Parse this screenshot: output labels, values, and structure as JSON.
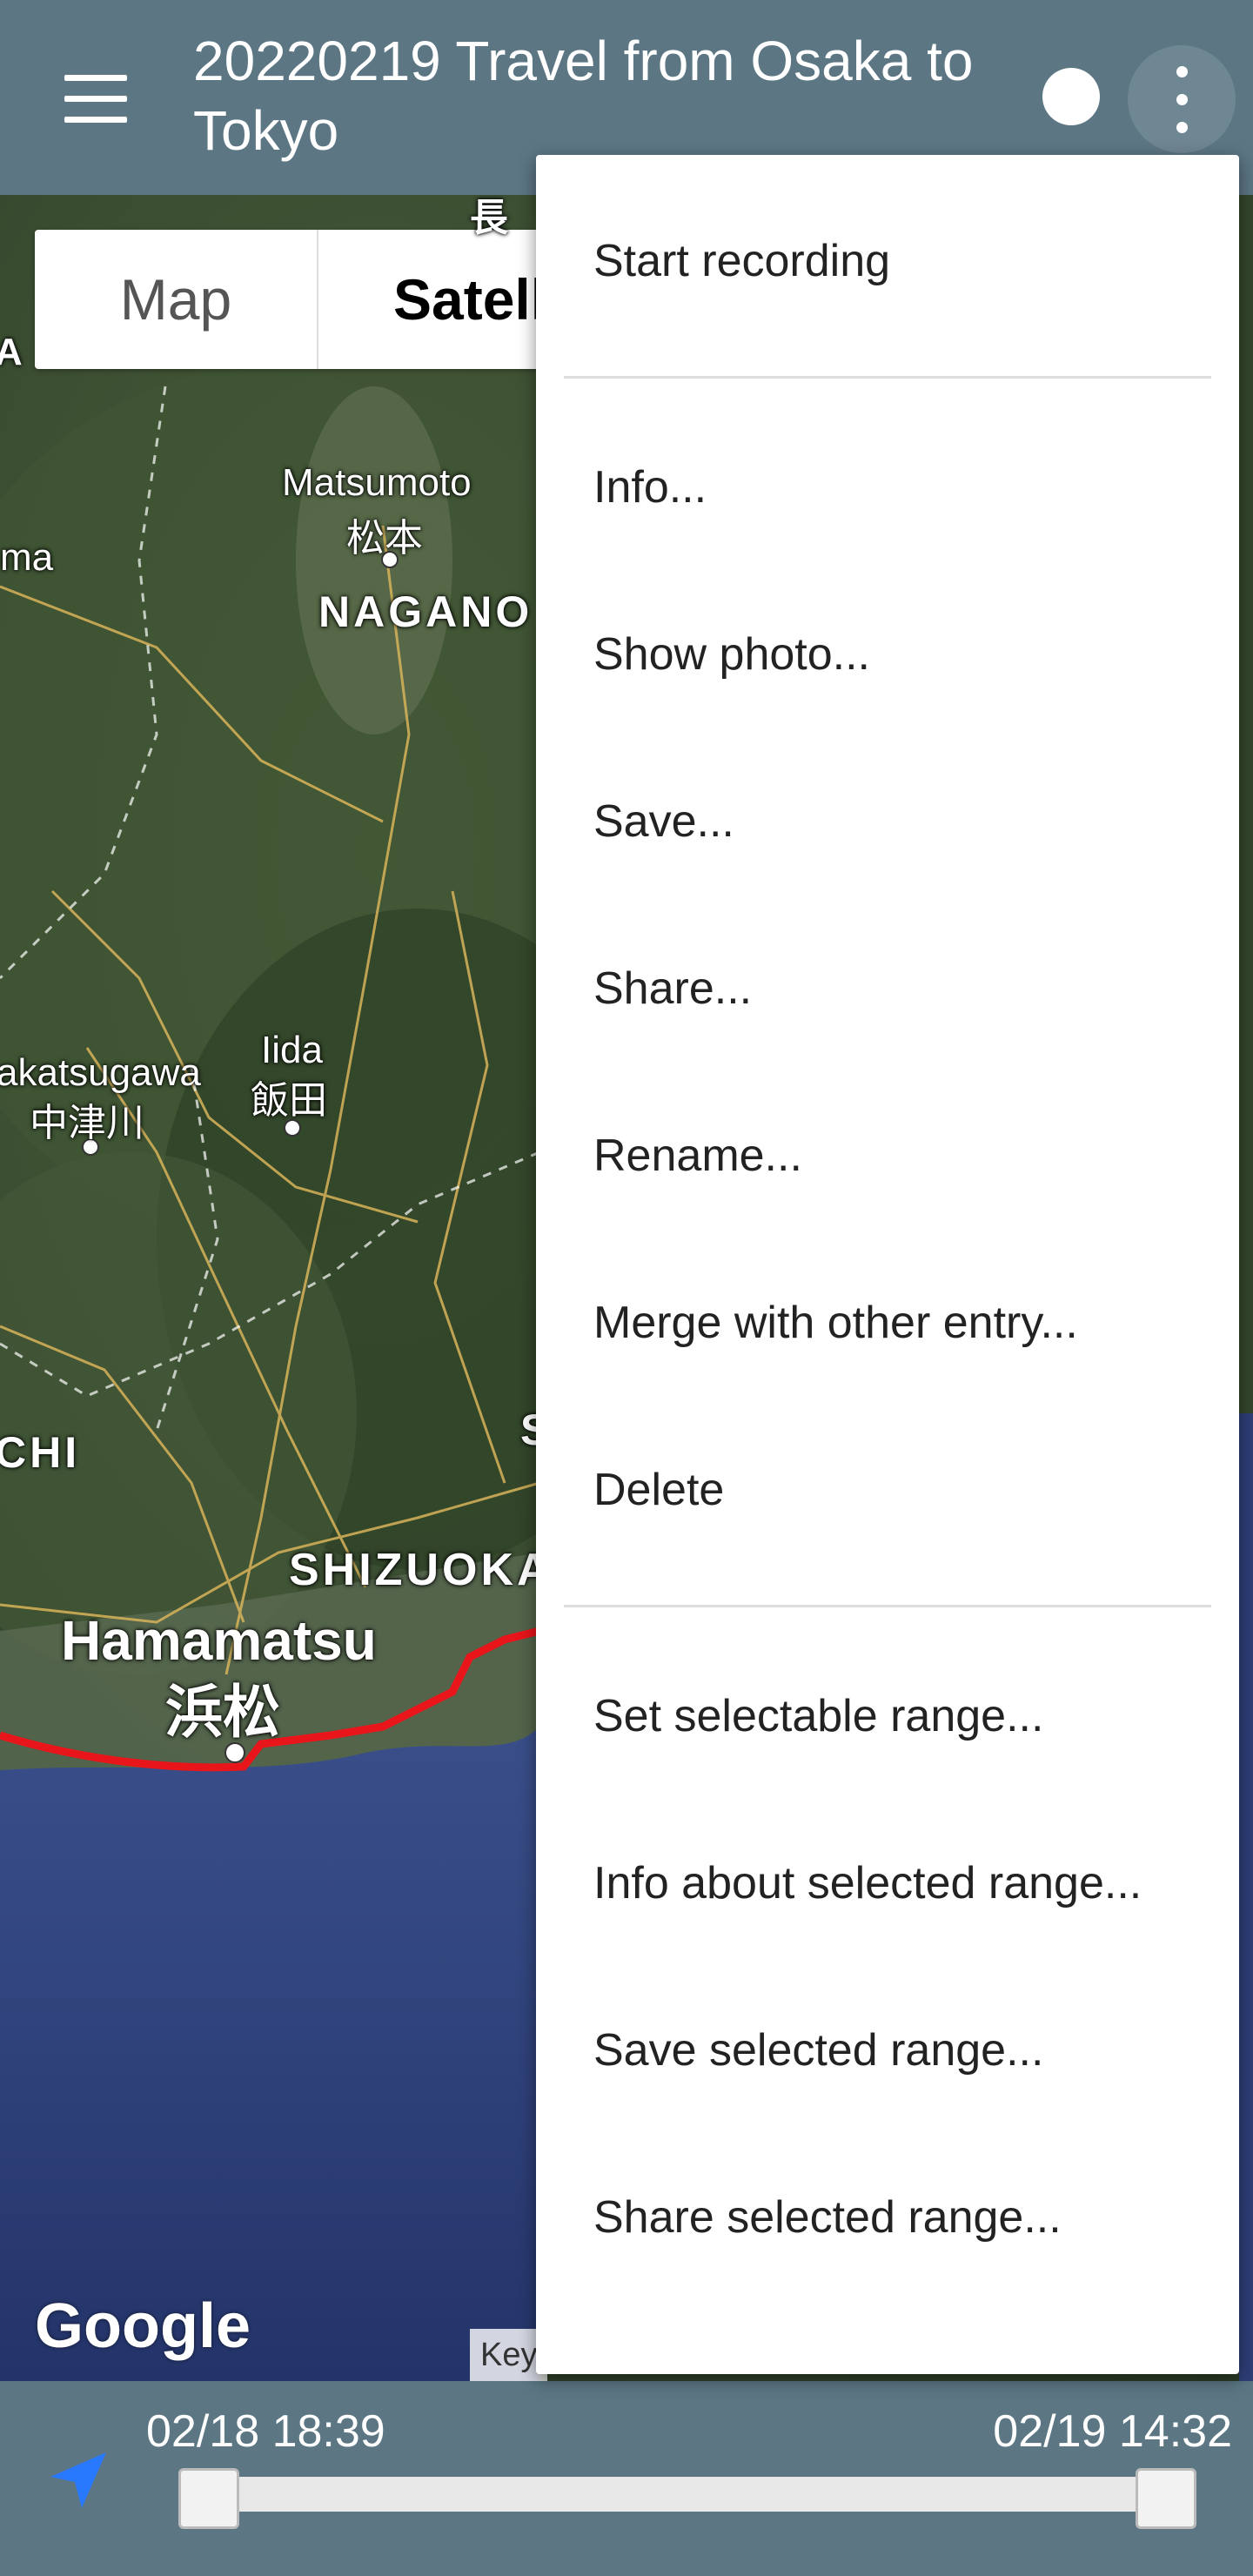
{
  "appbar": {
    "title": "20220219 Travel from Osaka to Tokyo",
    "menu_icon": "hamburger-icon",
    "record_icon": "record-dot-icon",
    "overflow_icon": "more-vert-icon"
  },
  "map": {
    "map_type": {
      "map_label": "Map",
      "satellite_label": "Satellite",
      "selected": "Satellite"
    },
    "labels": {
      "matsumoto_en": "Matsumoto",
      "matsumoto_jp": "松本",
      "nagano": "NAGANO",
      "iida_en": "Iida",
      "iida_jp": "飯田",
      "nakatsugawa_en": "akatsugawa",
      "nakatsugawa_jp": "中津川",
      "shizuoka": "SHIZUOKA",
      "hamamatsu_en": "Hamamatsu",
      "hamamatsu_jp": "浜松",
      "chi": "CHI",
      "nagano_top": "長",
      "edge_a": "A",
      "edge_ma": "ma",
      "edge_s": "S"
    },
    "attribution": "Google",
    "keyboard_link": "Key",
    "route_color": "#e8151b"
  },
  "menu": {
    "items": [
      {
        "label": "Start recording"
      },
      {
        "label": "Info..."
      },
      {
        "label": "Show photo..."
      },
      {
        "label": "Save..."
      },
      {
        "label": "Share..."
      },
      {
        "label": "Rename..."
      },
      {
        "label": "Merge with other entry..."
      },
      {
        "label": "Delete"
      },
      {
        "label": "Set selectable range..."
      },
      {
        "label": "Info about selected range..."
      },
      {
        "label": "Save selected range..."
      },
      {
        "label": "Share selected range..."
      }
    ]
  },
  "bottombar": {
    "start_time": "02/18 18:39",
    "end_time": "02/19 14:32",
    "nav_icon": "navigation-arrow-icon",
    "range_start_fraction": 0.0,
    "range_end_fraction": 1.0
  },
  "colors": {
    "appbar": "#5c7684",
    "menu_bg": "#ffffff",
    "nav_arrow": "#2979ff"
  }
}
